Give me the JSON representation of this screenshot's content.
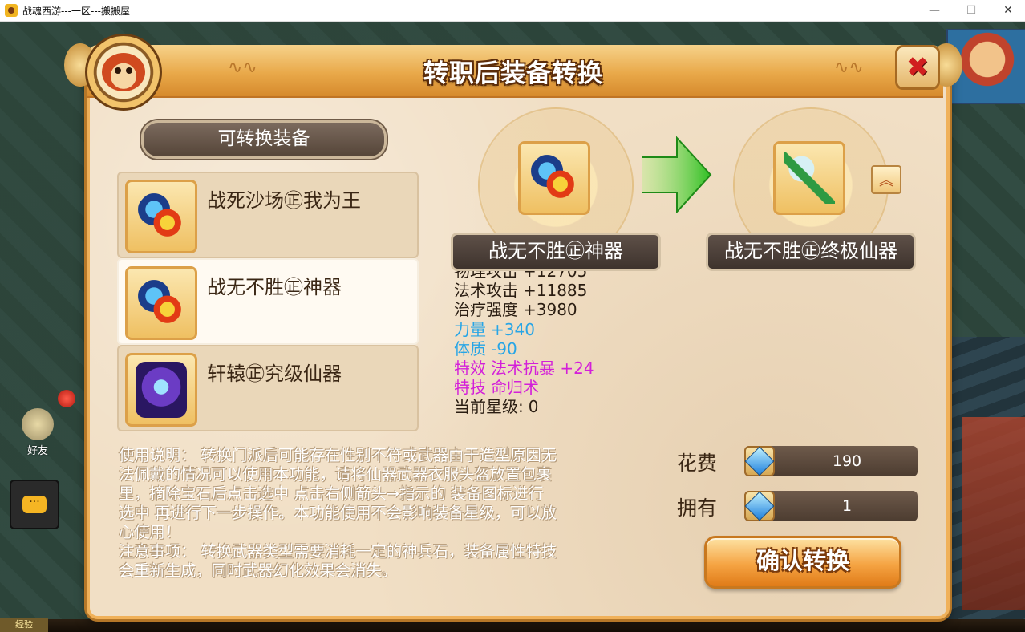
{
  "window": {
    "title": "战魂西游---一区---搬搬屋",
    "minimize": "—",
    "maximize": "☐",
    "close": "✕"
  },
  "game": {
    "friend_label": "好友",
    "exp_label": "经验",
    "chat_glyph": "···"
  },
  "dialog": {
    "title": "转职后装备转换",
    "close_glyph": "✖",
    "section_title": "可转换装备",
    "items": [
      {
        "name": "战死沙场㊣我为王",
        "icon": "claw-weapon-icon",
        "selected": false
      },
      {
        "name": "战无不胜㊣神器",
        "icon": "claw-weapon-icon",
        "selected": true
      },
      {
        "name": "轩辕㊣究级仙器",
        "icon": "armor-icon",
        "selected": false
      }
    ],
    "source_name": "战无不胜㊣神器",
    "target_name": "战无不胜㊣终极仙器",
    "up_glyph": "︽",
    "stats": [
      {
        "key": "物理攻击",
        "value": "+12705",
        "color": "dark"
      },
      {
        "key": "法术攻击",
        "value": "+11885",
        "color": "dark"
      },
      {
        "key": "治疗强度",
        "value": "+3980",
        "color": "dark"
      },
      {
        "key": "力量",
        "value": "+340",
        "color": "blue"
      },
      {
        "key": "体质",
        "value": "-90",
        "color": "blue"
      },
      {
        "key": "特效",
        "value": "法术抗暴 +24",
        "color": "purple"
      },
      {
        "key": "特技",
        "value": "命归术",
        "color": "purple"
      },
      {
        "key": "当前星级:",
        "value": "0",
        "color": "dark"
      }
    ],
    "instructions": [
      "使用说明： 转换门派后可能存在性别不符或武器由于造型原因无",
      "法佩戴的情况可以使用本功能，请将仙器武器衣服头盔放置包裹",
      "里，摘除宝石后点击选中 点击右侧箭头→指示的 装备图标进行",
      "选中 再进行下一步操作。本功能使用不会影响装备星级，可以放",
      "心使用！",
      "注意事项： 转换武器类型需要消耗一定的神兵石，装备属性特技",
      "会重新生成，同时武器幻化效果会消失。"
    ],
    "cost_label": "花费",
    "cost_value": "190",
    "own_label": "拥有",
    "own_value": "1",
    "confirm_label": "确认转换"
  },
  "colors": {
    "accent": "#f0b15a",
    "stat_blue": "#27a5e6",
    "stat_purple": "#d31fd9",
    "close_red": "#d11f1f"
  }
}
